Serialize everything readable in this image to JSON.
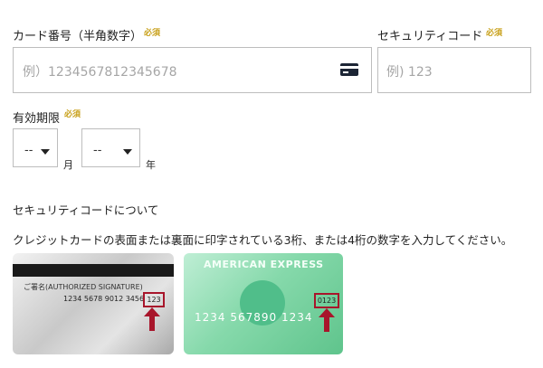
{
  "card_number": {
    "label": "カード番号（半角数字）",
    "required_badge": "必須",
    "placeholder": "例）1234567812345678",
    "icon": "credit-card-icon"
  },
  "security_code": {
    "label": "セキュリティコード",
    "required_badge": "必須",
    "placeholder": "例) 123"
  },
  "expiry": {
    "label": "有効期限",
    "required_badge": "必須",
    "month_value": "--",
    "month_unit": "月",
    "year_value": "--",
    "year_unit": "年"
  },
  "about": {
    "heading": "セキュリティコードについて",
    "description": "クレジットカードの表面または裏面に印字されている3桁、または4桁の数字を入力してください。"
  },
  "card_back": {
    "signature_label": "ご署名(AUTHORIZED SIGNATURE)",
    "number_text": "1234 5678 9012 3456",
    "code": "123"
  },
  "card_front": {
    "brand": "AMERICAN EXPRESS",
    "number_text": "1234  567890  1234",
    "code": "0123"
  },
  "colors": {
    "required": "#c8a019",
    "highlight": "#a8152b",
    "amex_green": "#6fcf9a"
  }
}
